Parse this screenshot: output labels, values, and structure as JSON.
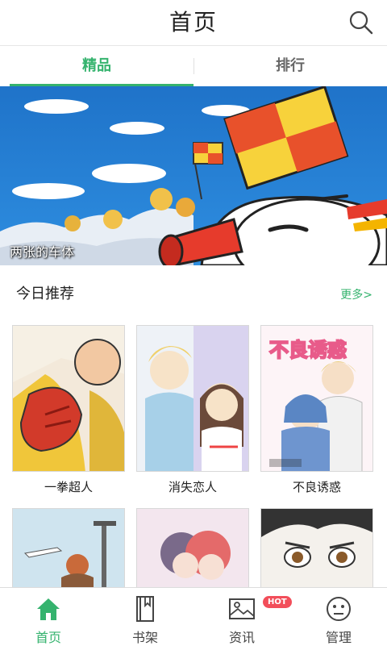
{
  "header": {
    "title": "首页",
    "search_icon": "search-icon"
  },
  "tabs": [
    {
      "label": "精品",
      "active": true
    },
    {
      "label": "排行",
      "active": false
    }
  ],
  "banner": {
    "caption": "两张的车体",
    "dots": 5,
    "active_dot": 0
  },
  "section": {
    "title": "今日推荐",
    "more": "更多>"
  },
  "comics": [
    {
      "title": "一拳超人"
    },
    {
      "title": "消失恋人"
    },
    {
      "title": "不良诱惑"
    },
    {
      "title": ""
    },
    {
      "title": ""
    },
    {
      "title": ""
    }
  ],
  "covers": {
    "third_cover_title": "不良诱惑"
  },
  "bottom_nav": [
    {
      "label": "首页",
      "icon": "home-icon",
      "active": true
    },
    {
      "label": "书架",
      "icon": "bookshelf-icon",
      "active": false
    },
    {
      "label": "资讯",
      "icon": "image-icon",
      "active": false,
      "badge": "HOT"
    },
    {
      "label": "管理",
      "icon": "face-icon",
      "active": false
    }
  ],
  "colors": {
    "accent": "#35b36e",
    "badge": "#f24e5a"
  }
}
